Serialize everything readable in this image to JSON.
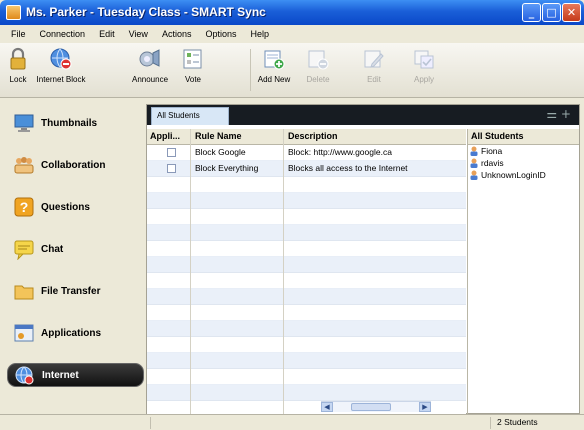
{
  "window": {
    "title": "Ms.   Parker - Tuesday Class - SMART Sync"
  },
  "menu": [
    "File",
    "Connection",
    "Edit",
    "View",
    "Actions",
    "Options",
    "Help"
  ],
  "toolbar": {
    "items": [
      {
        "label": "Lock",
        "icon": "padlock-icon",
        "enabled": true
      },
      {
        "label": "Internet Block",
        "icon": "globe-block-icon",
        "enabled": true
      },
      {
        "label": "Announce",
        "icon": "announce-icon",
        "enabled": true
      },
      {
        "label": "Vote",
        "icon": "vote-icon",
        "enabled": true
      },
      {
        "label": "Add New",
        "icon": "add-new-icon",
        "enabled": true
      },
      {
        "label": "Delete",
        "icon": "delete-icon",
        "enabled": false
      },
      {
        "label": "Edit",
        "icon": "edit-icon",
        "enabled": false
      },
      {
        "label": "Apply",
        "icon": "apply-icon",
        "enabled": false
      }
    ]
  },
  "nav": {
    "items": [
      {
        "label": "Thumbnails",
        "icon": "monitor-icon"
      },
      {
        "label": "Collaboration",
        "icon": "group-icon"
      },
      {
        "label": "Questions",
        "icon": "question-icon"
      },
      {
        "label": "Chat",
        "icon": "chat-icon"
      },
      {
        "label": "File Transfer",
        "icon": "folder-icon"
      },
      {
        "label": "Applications",
        "icon": "applications-icon"
      },
      {
        "label": "Internet",
        "icon": "internet-icon",
        "active": true
      }
    ]
  },
  "content": {
    "tab": "All Students",
    "columns": [
      "Appli...",
      "Rule Name",
      "Description"
    ],
    "rows": [
      {
        "rule": "Block Google",
        "description": "Block: http://www.google.ca"
      },
      {
        "rule": "Block Everything",
        "description": "Blocks all access to the Internet"
      }
    ]
  },
  "students": {
    "header": "All Students",
    "items": [
      "Fiona",
      "rdavis",
      "UnknownLoginID"
    ]
  },
  "status": {
    "count": "2 Students"
  },
  "colors": {
    "title_bar": "#1a5fd8",
    "tab_strip": "#171c22",
    "active_nav": "#111111"
  }
}
